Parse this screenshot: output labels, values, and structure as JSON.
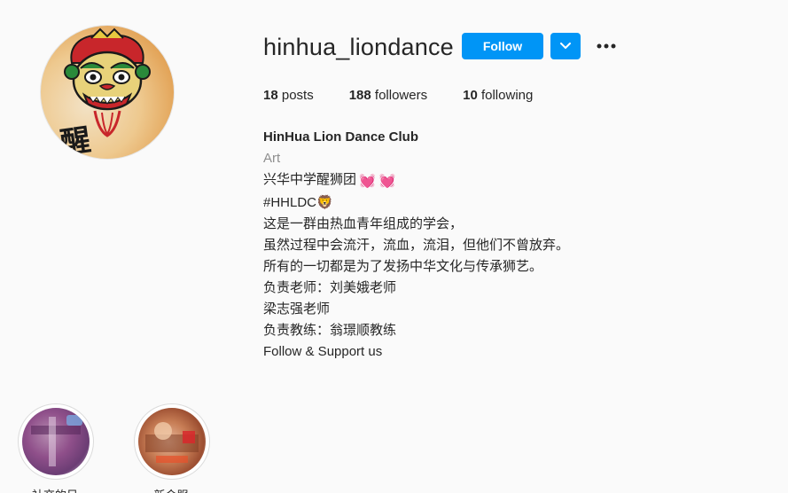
{
  "profile": {
    "username": "hinhua_liondance",
    "follow_label": "Follow",
    "stats": {
      "posts_count": "18",
      "posts_label": " posts",
      "followers_count": "188",
      "followers_label": " followers",
      "following_count": "10",
      "following_label": " following"
    },
    "bio": {
      "full_name": "HinHua Lion Dance Club",
      "category": "Art",
      "lines": [
        "兴华中学醒狮团",
        "#HHLDC",
        "这是一群由热血青年组成的学会，",
        "虽然过程中会流汗，流血，流泪，但他们不曾放弃。",
        "所有的一切都是为了发扬中华文化与传承狮艺。",
        "负责老师：刘美娥老师",
        "梁志强老师",
        "负责教练：翁璟顺教练",
        "Follow & Support us"
      ],
      "emojis": {
        "line0": "💓 💓",
        "line1": "🦁"
      }
    },
    "avatar_text": "醒",
    "highlights": [
      {
        "label": "社交的日"
      },
      {
        "label": "新会服"
      }
    ]
  },
  "colors": {
    "accent": "#0095f6",
    "text": "#262626",
    "muted": "#8e8e8e",
    "background": "#fafafa"
  },
  "icons": {
    "dropdown": "chevron-down-icon",
    "more": "more-options-icon",
    "heart": "pink-heart-icon",
    "lion": "lion-face-icon"
  }
}
